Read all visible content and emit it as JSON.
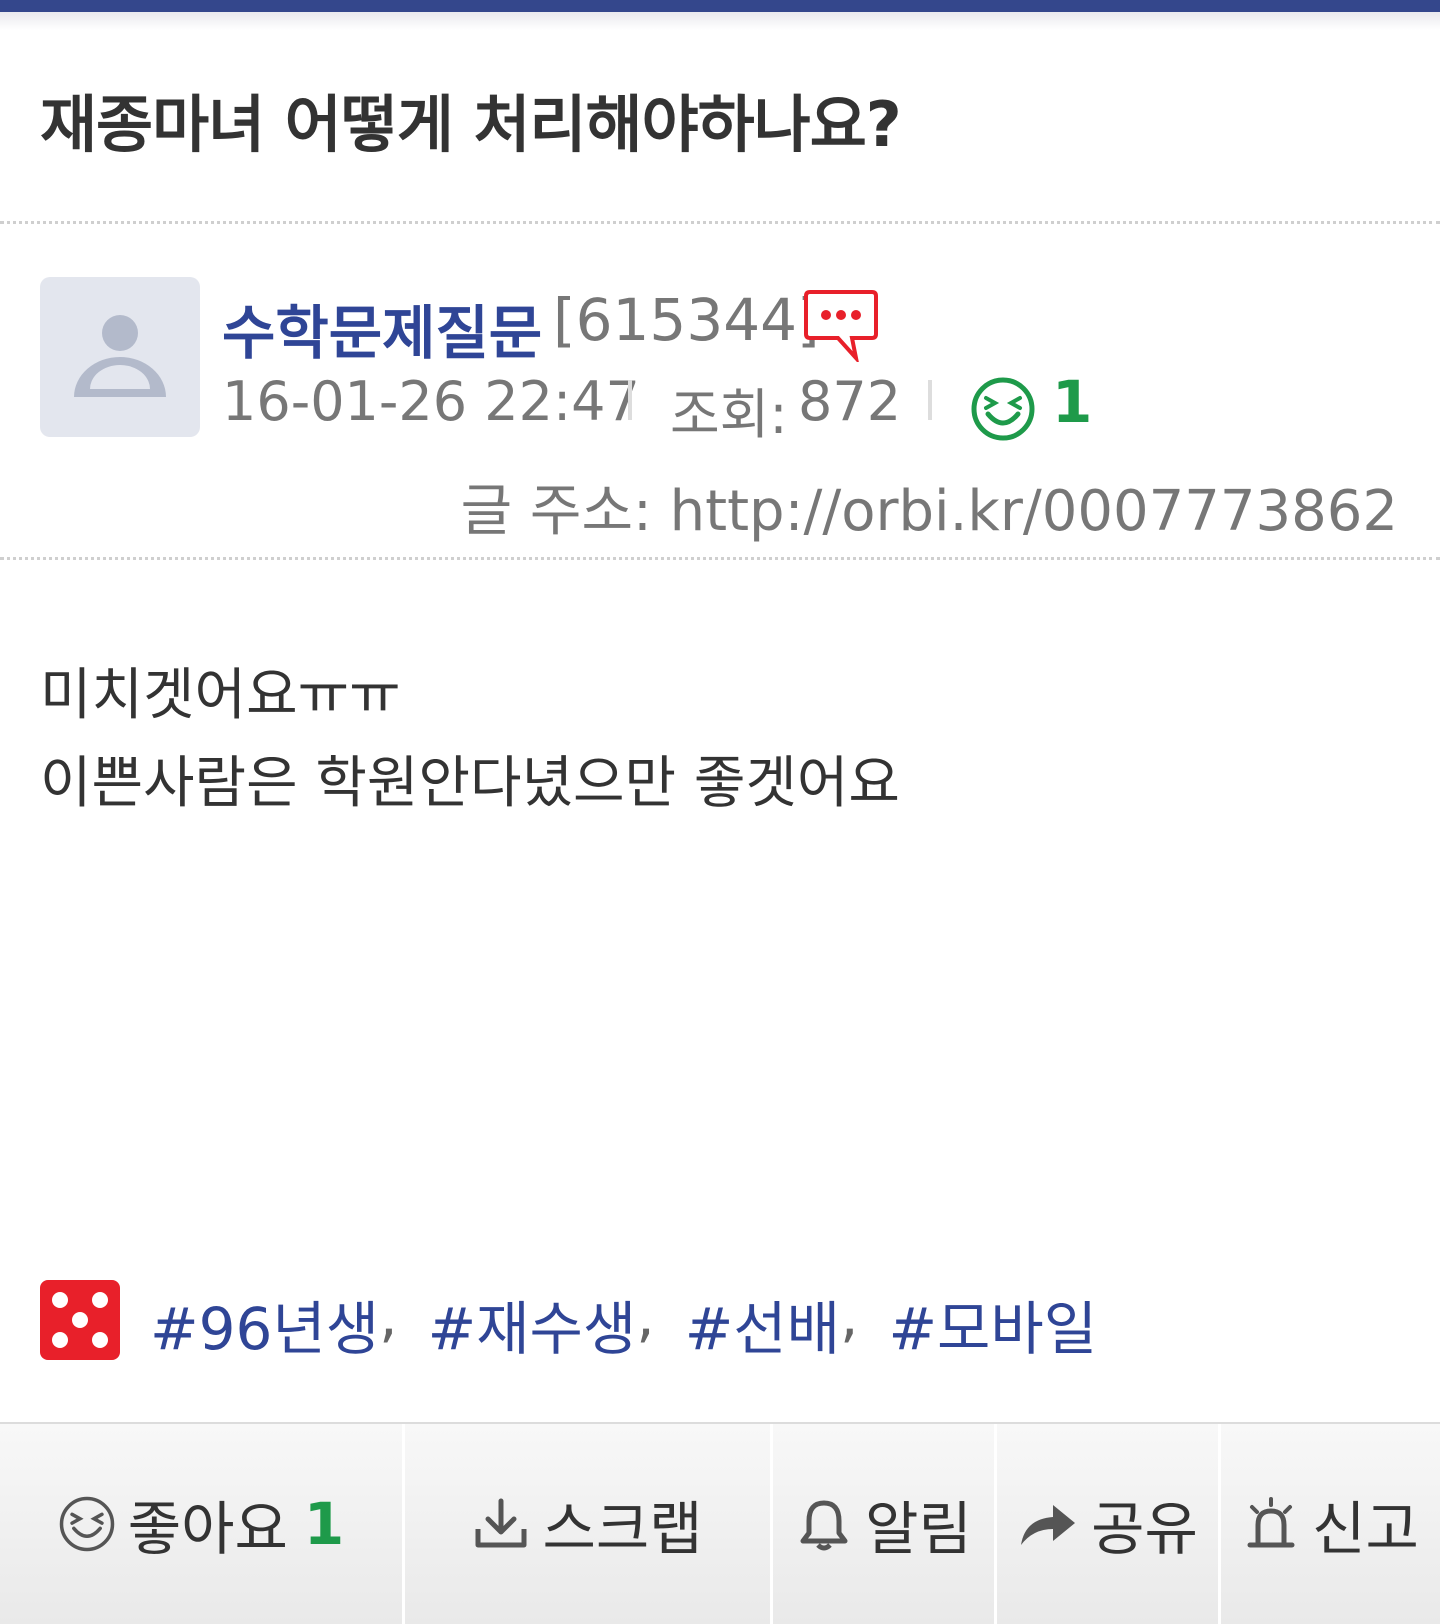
{
  "post": {
    "title": "재종마녀 어떻게 처리해야하나요?",
    "author": {
      "nickname": "수학문제질문",
      "user_id": "[615344]",
      "avatar_icon": "default-user-avatar",
      "message_icon": "message-icon"
    },
    "meta": {
      "datetime": "16-01-26 22:47",
      "views_label": "조회:",
      "views": "872",
      "like_icon": "laughing-face-icon",
      "likes": "1",
      "url": "글 주소: http://orbi.kr/0007773862"
    },
    "body": [
      "미치겟어요ㅠㅠ",
      "이쁜사람은 학원안다녔으만 좋겟어요"
    ],
    "tags": [
      "#96년생",
      "#재수생",
      "#선배",
      "#모바일"
    ],
    "tag_separator": ","
  },
  "toolbar": {
    "like_label": "좋아요",
    "like_count": "1",
    "scrap_label": "스크랩",
    "alert_label": "알림",
    "share_label": "공유",
    "report_label": "신고"
  },
  "colors": {
    "header_bar": "#34478c",
    "nickname": "#2f4596",
    "like_green": "#1e9a4a",
    "icon_red": "#e8202a"
  }
}
